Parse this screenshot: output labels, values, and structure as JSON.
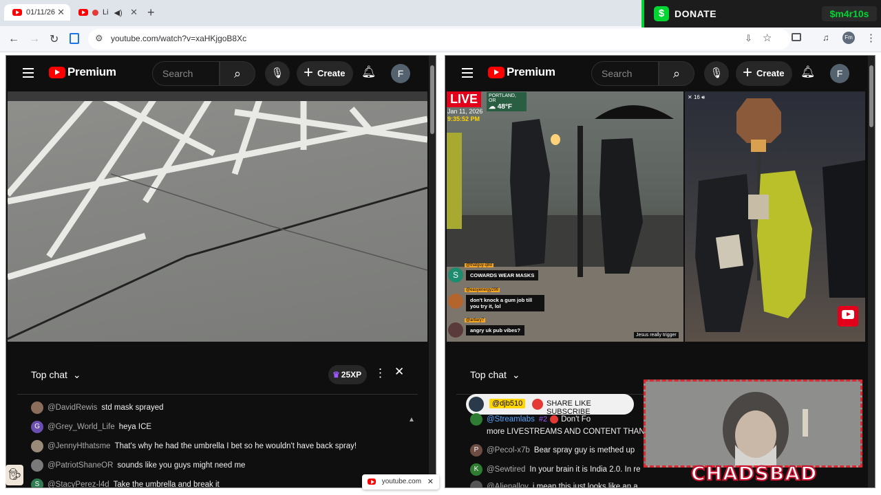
{
  "browser": {
    "tabs": [
      {
        "title": "01/11/26"
      },
      {
        "title": "Li"
      }
    ],
    "url": "youtube.com/watch?v=xaHKjgoB8Xc",
    "toast_domain": "youtube.com"
  },
  "donate": {
    "label": "DONATE",
    "cashtag": "$m4r10s",
    "accent": "#00d632"
  },
  "left_pane": {
    "brand": "Premium",
    "search_placeholder": "Search",
    "create_label": "Create",
    "avatar_letter": "F",
    "chat": {
      "mode": "Top chat",
      "xp": "25XP",
      "messages": [
        {
          "user": "@DavidRewis",
          "text": "std mask sprayed",
          "initial": "",
          "color": "#8a6d5a"
        },
        {
          "user": "@Grey_World_Life",
          "text": "heya ICE",
          "initial": "G",
          "color": "#6a4fb0"
        },
        {
          "user": "@JennyHthatsme",
          "text": "That's why he had the umbrella I bet so he wouldn't have back spray!",
          "initial": "",
          "color": "#9a8a7a"
        },
        {
          "user": "@PatriotShaneOR",
          "text": "sounds like you guys might need me",
          "initial": "",
          "color": "#7a7a7a"
        },
        {
          "user": "@StacyPerez-l4d",
          "text": "Take the umbrella and break it",
          "initial": "S",
          "color": "#2e7d52"
        }
      ]
    }
  },
  "right_pane": {
    "brand": "Premium",
    "search_placeholder": "Search",
    "create_label": "Create",
    "avatar_letter": "F",
    "live_badge": "LIVE",
    "location": "PORTLAND, OR",
    "temperature": "48°F",
    "date": "Jan 11, 2026",
    "time": "9:35:52 PM",
    "overlay_chats": [
      {
        "user": "@thatguy-q8d",
        "text": "COWARDS WEAR MASKS",
        "initial": "S"
      },
      {
        "user": "@easyenergy299",
        "text": "don't knock a gum job till you try it, lol",
        "initial": ""
      },
      {
        "user": "@artlary7",
        "text": "angry uk pub vibes?",
        "initial": ""
      }
    ],
    "viewer_count": "16",
    "caption": "Jesus really trigger",
    "chat": {
      "mode": "Top chat",
      "pinned_user": "@djb510",
      "pinned_text": "SHARE LIKE SUBSCRIBE",
      "first_user": "@Streamlabs",
      "first_rank": "#2",
      "first_partial": "Don't Fo",
      "first_text": "more LIVESTREAMS AND CONTENT THAN",
      "messages": [
        {
          "user": "@Pecol-x7b",
          "text": "Bear spray guy is methed up",
          "initial": "P",
          "color": "#6d4c41"
        },
        {
          "user": "@Sewtired",
          "text": "In your brain it is India 2.0. In re",
          "initial": "K",
          "color": "#2e7d32"
        },
        {
          "user": "@Alienalloy",
          "text": "i mean this just looks like an a",
          "initial": "",
          "color": "#555555"
        }
      ]
    }
  },
  "webcam": {
    "banner": "CHADSBAD"
  }
}
